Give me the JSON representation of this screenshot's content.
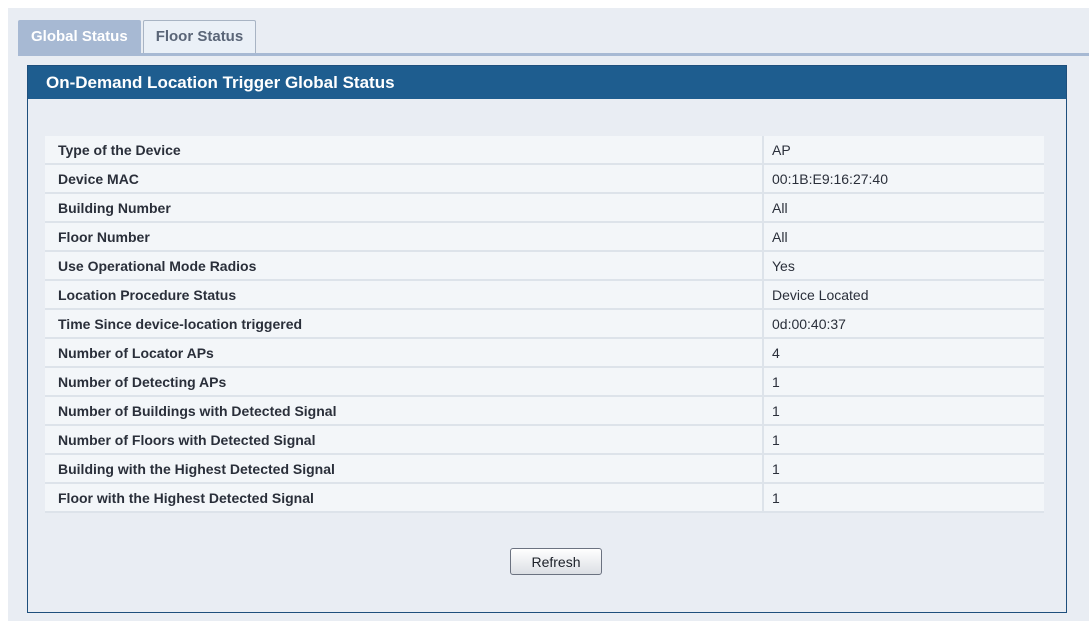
{
  "tabs": [
    {
      "label": "Global Status",
      "active": true
    },
    {
      "label": "Floor Status",
      "active": false
    }
  ],
  "panel": {
    "title": "On-Demand Location Trigger Global Status"
  },
  "rows": [
    {
      "label": "Type of the Device",
      "value": "AP"
    },
    {
      "label": "Device MAC",
      "value": "00:1B:E9:16:27:40"
    },
    {
      "label": "Building Number",
      "value": "All"
    },
    {
      "label": "Floor Number",
      "value": "All"
    },
    {
      "label": "Use Operational Mode Radios",
      "value": "Yes"
    },
    {
      "label": "Location Procedure Status",
      "value": "Device Located"
    },
    {
      "label": "Time Since device-location triggered",
      "value": "0d:00:40:37"
    },
    {
      "label": "Number of Locator APs",
      "value": "4"
    },
    {
      "label": "Number of Detecting APs",
      "value": "1"
    },
    {
      "label": "Number of Buildings with Detected Signal",
      "value": "1"
    },
    {
      "label": "Number of Floors with Detected Signal",
      "value": "1"
    },
    {
      "label": "Building with the Highest Detected Signal",
      "value": "1"
    },
    {
      "label": "Floor with the Highest Detected Signal",
      "value": "1"
    }
  ],
  "actions": {
    "refresh_label": "Refresh"
  },
  "colors": {
    "header_bg": "#1e5d8f",
    "active_tab_bg": "#a7b9d3",
    "panel_bg": "#e9edf3",
    "row_bg": "#f3f6f9"
  }
}
